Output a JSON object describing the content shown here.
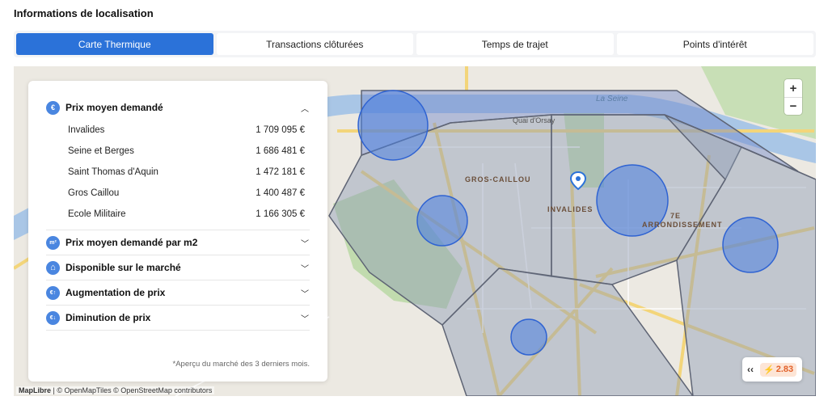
{
  "section": {
    "title": "Informations de localisation"
  },
  "tabs": [
    {
      "label": "Carte Thermique",
      "active": true
    },
    {
      "label": "Transactions clôturées",
      "active": false
    },
    {
      "label": "Temps de trajet",
      "active": false
    },
    {
      "label": "Points d'intérêt",
      "active": false
    }
  ],
  "panel": {
    "groups": [
      {
        "icon": "euro-icon",
        "icon_text": "€",
        "label": "Prix moyen demandé",
        "expanded": true,
        "rows": [
          {
            "name": "Invalides",
            "value": "1 709 095 €"
          },
          {
            "name": "Seine et Berges",
            "value": "1 686 481 €"
          },
          {
            "name": "Saint Thomas d'Aquin",
            "value": "1 472 181 €"
          },
          {
            "name": "Gros Caillou",
            "value": "1 400 487 €"
          },
          {
            "name": "Ecole Militaire",
            "value": "1 166 305 €"
          }
        ]
      },
      {
        "icon": "square-meter-icon",
        "icon_text": "m²",
        "label": "Prix moyen demandé par m2",
        "expanded": false
      },
      {
        "icon": "house-icon",
        "icon_text": "⌂",
        "label": "Disponible sur le marché",
        "expanded": false
      },
      {
        "icon": "euro-up-icon",
        "icon_text": "€↑",
        "label": "Augmentation de prix",
        "expanded": false
      },
      {
        "icon": "euro-down-icon",
        "icon_text": "€↓",
        "label": "Diminution de prix",
        "expanded": false
      }
    ],
    "note": "*Aperçu du marché des 3 derniers mois."
  },
  "map": {
    "labels": {
      "seine": "La Seine",
      "quai": "Quai d'Orsay",
      "gros_caillou": "GROS-CAILLOU",
      "invalides": "INVALIDES",
      "arr_line1": "7E",
      "arr_line2": "ARRONDISSEMENT"
    },
    "zoom_in": "+",
    "zoom_out": "−",
    "attribution_brand": "MapLibre",
    "attribution_rest": " | © OpenMapTiles © OpenStreetMap contributors",
    "badge": {
      "chevron": "‹‹",
      "bolt": "⚡",
      "score": "2.83"
    },
    "colors": {
      "bubble": "#4a7fe0",
      "district": "#9aa6bf",
      "water": "#a9c6e6",
      "park": "#bcd9a8",
      "road": "#f3d57a"
    }
  }
}
